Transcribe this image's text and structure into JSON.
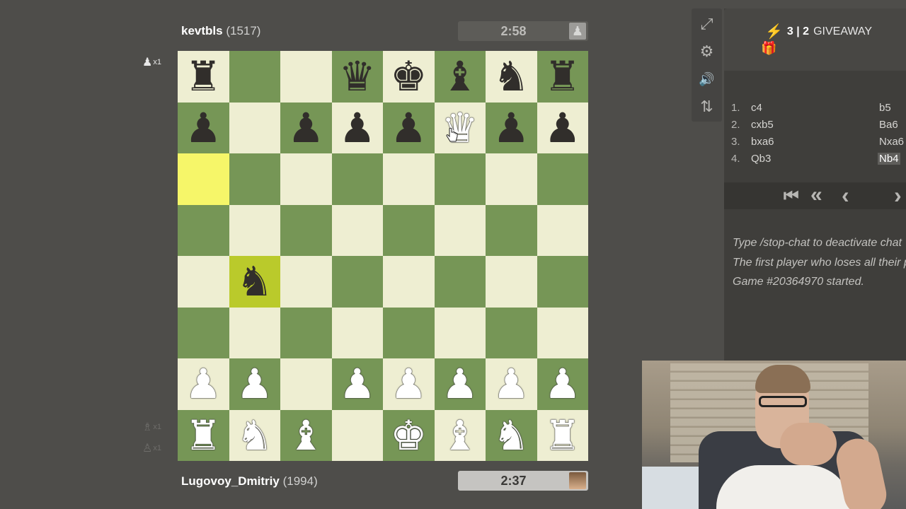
{
  "top_player": {
    "name": "kevtbls",
    "rating": "(1517)",
    "clock": "2:58",
    "captured_count": "x1"
  },
  "bottom_player": {
    "name": "Lugovoy_Dmitriy",
    "rating": "(1994)",
    "clock": "2:37",
    "captured": [
      {
        "count": "x1"
      },
      {
        "count": "x1"
      }
    ]
  },
  "board": {
    "orientation": "white-bottom",
    "ranks": [
      [
        "br",
        "",
        "",
        "bq",
        "bk",
        "bb",
        "bn",
        "br"
      ],
      [
        "bp",
        "",
        "bp",
        "bp",
        "bp",
        "wq",
        "bp",
        "bp"
      ],
      [
        "",
        "",
        "",
        "",
        "",
        "",
        "",
        ""
      ],
      [
        "",
        "",
        "",
        "",
        "",
        "",
        "",
        ""
      ],
      [
        "",
        "bn",
        "",
        "",
        "",
        "",
        "",
        ""
      ],
      [
        "",
        "",
        "",
        "",
        "",
        "",
        "",
        ""
      ],
      [
        "wp",
        "wp",
        "",
        "wp",
        "wp",
        "wp",
        "wp",
        "wp"
      ],
      [
        "wr",
        "wn",
        "wb",
        "",
        "wk",
        "wb",
        "wn",
        "wr"
      ]
    ],
    "highlighted_squares": [
      "a6",
      "b4"
    ],
    "colors": {
      "light": "#eeeed2",
      "dark": "#769656",
      "highlight_light": "#f6f669",
      "highlight_dark": "#baca2b"
    }
  },
  "tools": [
    {
      "name": "fullscreen-icon",
      "glyph": "⤢"
    },
    {
      "name": "gear-icon",
      "glyph": "⚙"
    },
    {
      "name": "sound-icon",
      "glyph": "🔊"
    },
    {
      "name": "flip-board-icon",
      "glyph": "⇅"
    }
  ],
  "game_info": {
    "time_control": "3 | 2",
    "variant": "GIVEAWAY",
    "bolt_icon": "⚡",
    "gift_icon": "🎁"
  },
  "moves": [
    {
      "num": "1.",
      "white": "c4",
      "black": "b5"
    },
    {
      "num": "2.",
      "white": "cxb5",
      "black": "Ba6"
    },
    {
      "num": "3.",
      "white": "bxa6",
      "black": "Nxa6"
    },
    {
      "num": "4.",
      "white": "Qb3",
      "black": "Nb4"
    }
  ],
  "nav": {
    "first": "⏮",
    "prev_fast": "«",
    "prev": "‹",
    "next": "›"
  },
  "chat": [
    "Type /stop-chat to deactivate chat",
    "The first player who loses all their pieces wins.",
    "Game #20364970 started."
  ]
}
